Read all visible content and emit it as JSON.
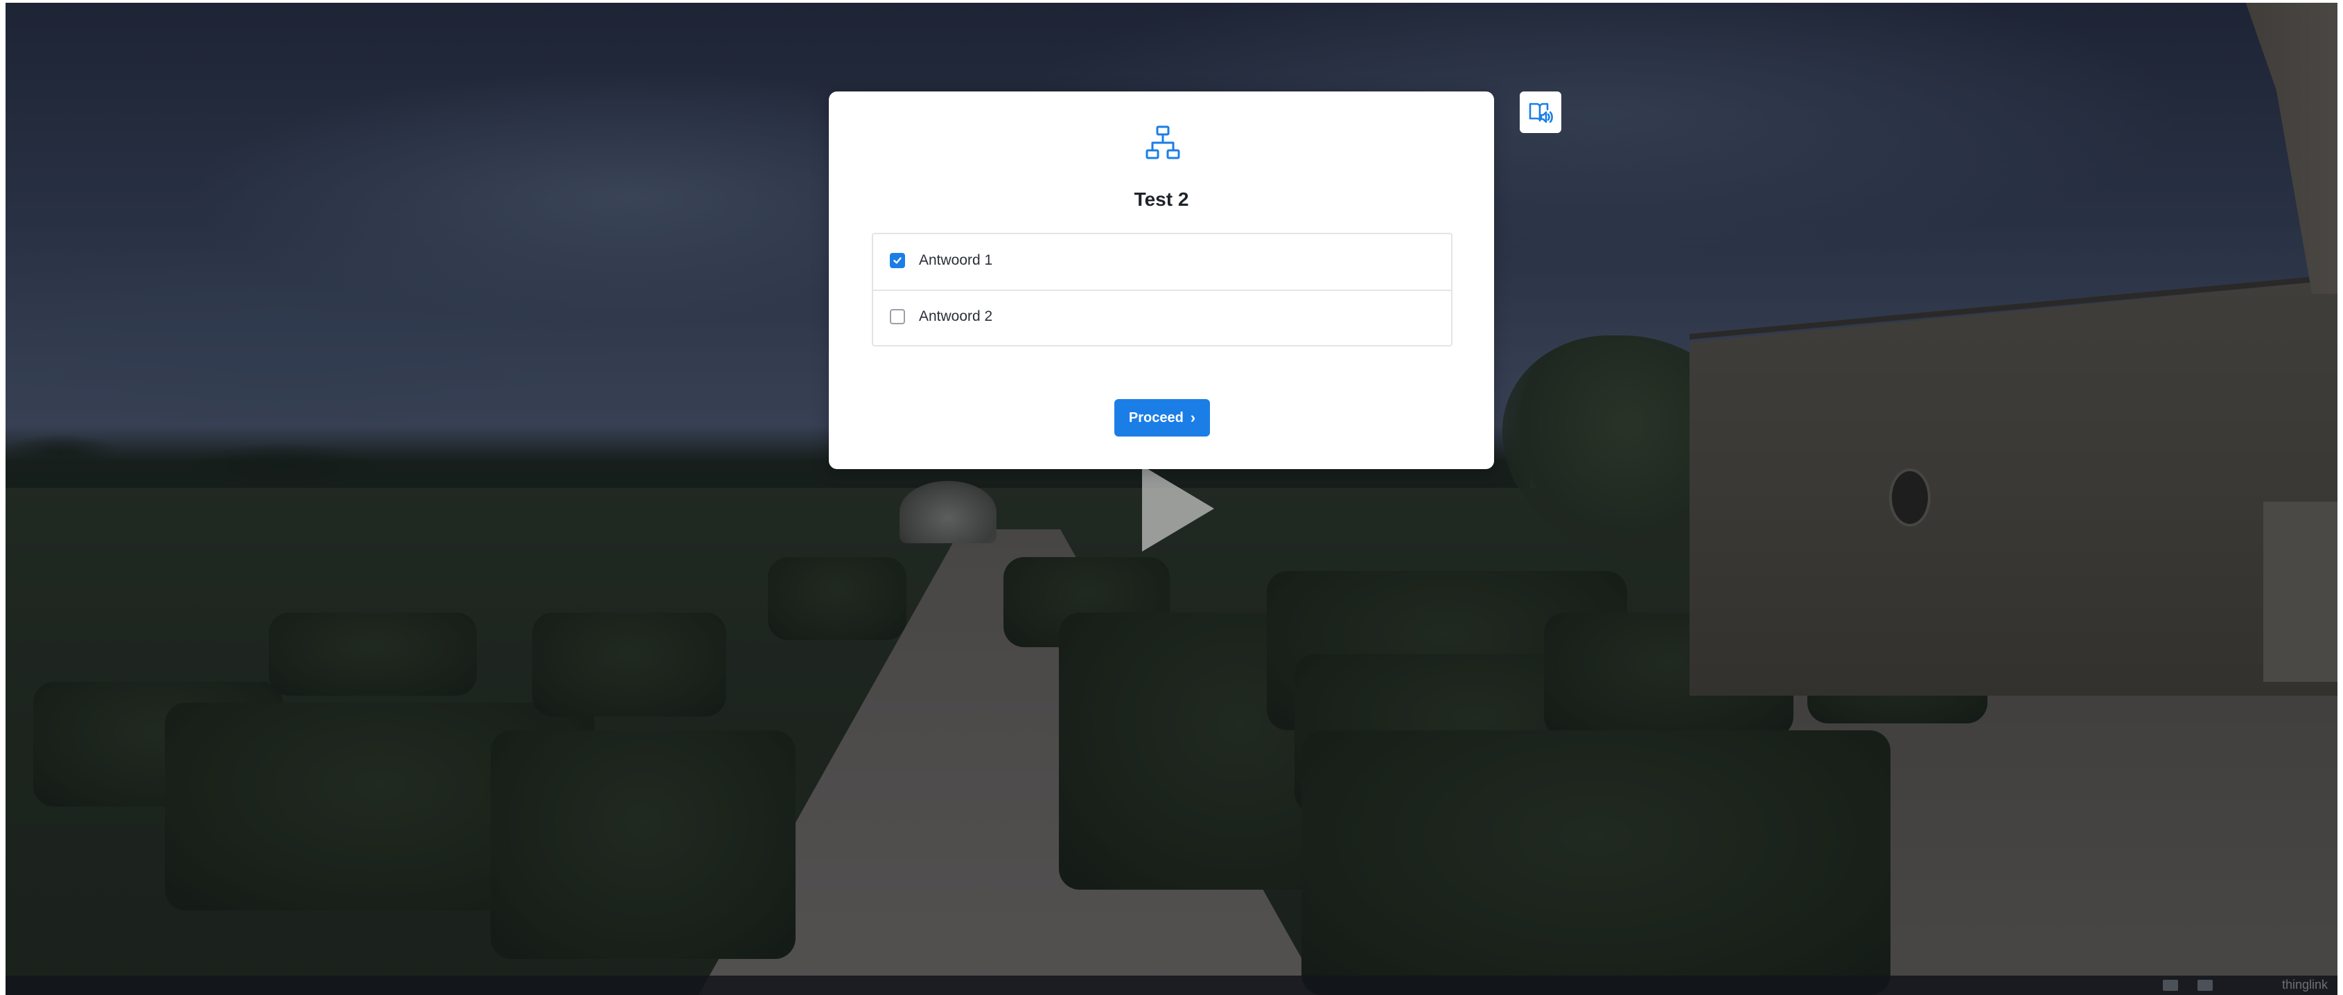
{
  "modal": {
    "title": "Test 2",
    "answers": [
      {
        "label": "Antwoord 1",
        "checked": true
      },
      {
        "label": "Antwoord 2",
        "checked": false
      }
    ],
    "proceed_label": "Proceed",
    "icon": "sitemap-icon"
  },
  "toolbar": {
    "audio_icon": "immersive-reader-icon"
  },
  "player": {
    "play_icon": "play-icon",
    "brand": "thinglink"
  },
  "colors": {
    "accent": "#1b7ee6",
    "modal_bg": "#ffffff",
    "title_text": "#1f2329"
  }
}
